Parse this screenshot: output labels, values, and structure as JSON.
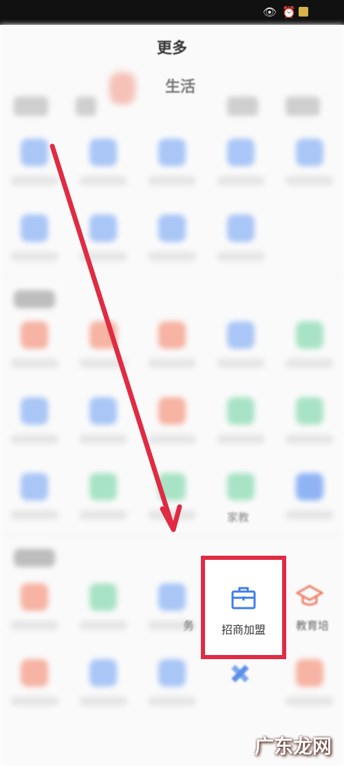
{
  "header": {
    "title": "更多"
  },
  "category_tabs": {
    "active_label": "生活"
  },
  "partial_labels": {
    "grid_row6_label": "家教",
    "row7_left_label": "务",
    "row7_right_label": "教育培"
  },
  "highlight": {
    "label": "招商加盟",
    "icon": "briefcase-icon"
  },
  "watermark": {
    "text": "广东龙网"
  },
  "colors": {
    "highlight_border": "#e02b43",
    "arrow": "#e02b43",
    "icon_blue": "#3d7cf0",
    "icon_red": "#f07a62",
    "icon_green": "#3fbf7f"
  }
}
